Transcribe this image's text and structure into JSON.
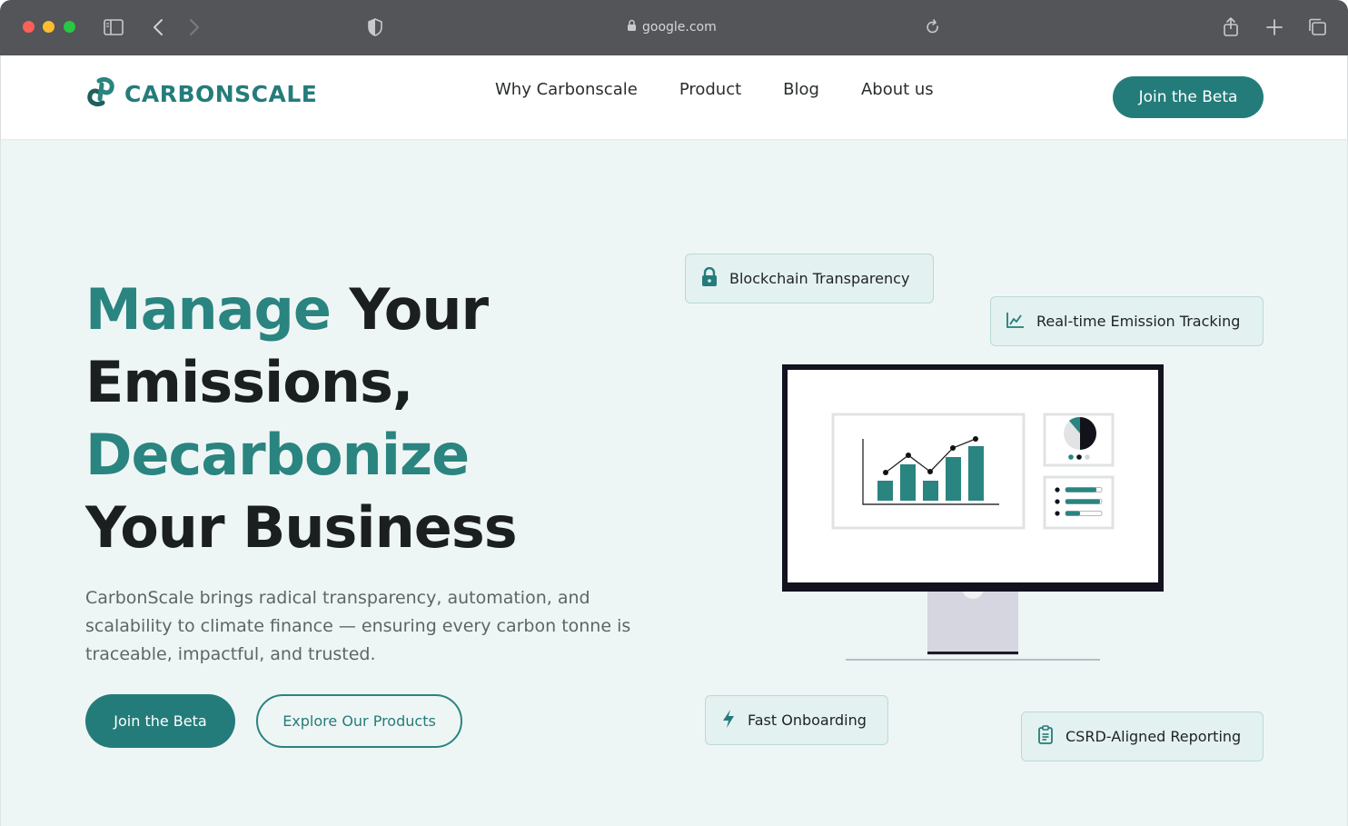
{
  "browser": {
    "url": "google.com",
    "icons": [
      "sidebar-icon",
      "back-icon",
      "forward-icon",
      "shield-icon",
      "lock-icon",
      "reload-icon",
      "share-icon",
      "new-tab-icon",
      "tabs-overview-icon"
    ]
  },
  "nav": {
    "logo_text": "CARBONSCALE",
    "links": [
      "Why Carbonscale",
      "Product",
      "Blog",
      "About us"
    ],
    "cta_label": "Join the Beta"
  },
  "hero": {
    "title_line1_accent": "Manage",
    "title_line1_rest": " Your",
    "title_line2": "Emissions,",
    "title_line3_accent": "Decarbonize",
    "title_line4": "Your Business",
    "description": "CarbonScale brings radical transparency, automation, and scalability to climate finance — ensuring every carbon tonne is traceable, impactful, and trusted.",
    "primary_button": "Join the Beta",
    "secondary_button": "Explore Our Products"
  },
  "features": {
    "blockchain": "Blockchain Transparency",
    "tracking": "Real-time Emission Tracking",
    "onboarding": "Fast Onboarding",
    "reporting": "CSRD-Aligned Reporting"
  },
  "colors": {
    "brand": "#247c7a",
    "hero_background": "#eef6f5",
    "chrome": "#545559"
  }
}
